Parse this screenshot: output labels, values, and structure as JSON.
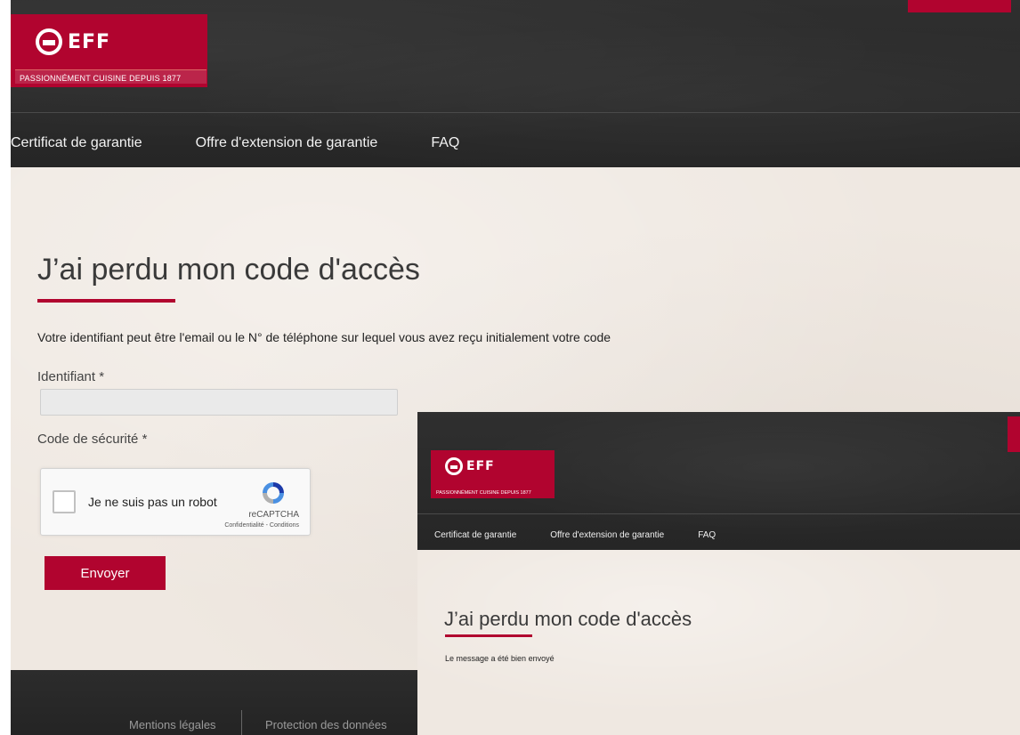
{
  "brand": {
    "logo_text": "EFF",
    "tagline": "PASSIONNÉMENT CUISINE DEPUIS 1877"
  },
  "nav": {
    "items": [
      {
        "label": "Certificat de garantie"
      },
      {
        "label": "Offre d'extension de garantie"
      },
      {
        "label": "FAQ"
      }
    ]
  },
  "form": {
    "title": "J’ai perdu mon code d'accès",
    "description": "Votre identifiant peut être l'email ou le N° de téléphone sur lequel vous avez reçu initialement votre code",
    "identifiant_label": "Identifiant *",
    "identifiant_value": "",
    "code_label": "Code de sécurité *",
    "captcha": {
      "label": "Je ne suis pas un robot",
      "brand": "reCAPTCHA",
      "links": "Confidentialité - Conditions"
    },
    "submit_label": "Envoyer"
  },
  "footer": {
    "links": [
      "Mentions légales",
      "Protection des données"
    ]
  },
  "confirmation": {
    "nav": [
      "Certificat de garantie",
      "Offre d'extension de garantie",
      "FAQ"
    ],
    "title": "J’ai perdu mon code d'accès",
    "message": "Le message a été bien envoyé"
  },
  "colors": {
    "brand_red": "#b1042f",
    "header_dark": "#2b2b2b",
    "content_bg": "#efe8e1"
  }
}
